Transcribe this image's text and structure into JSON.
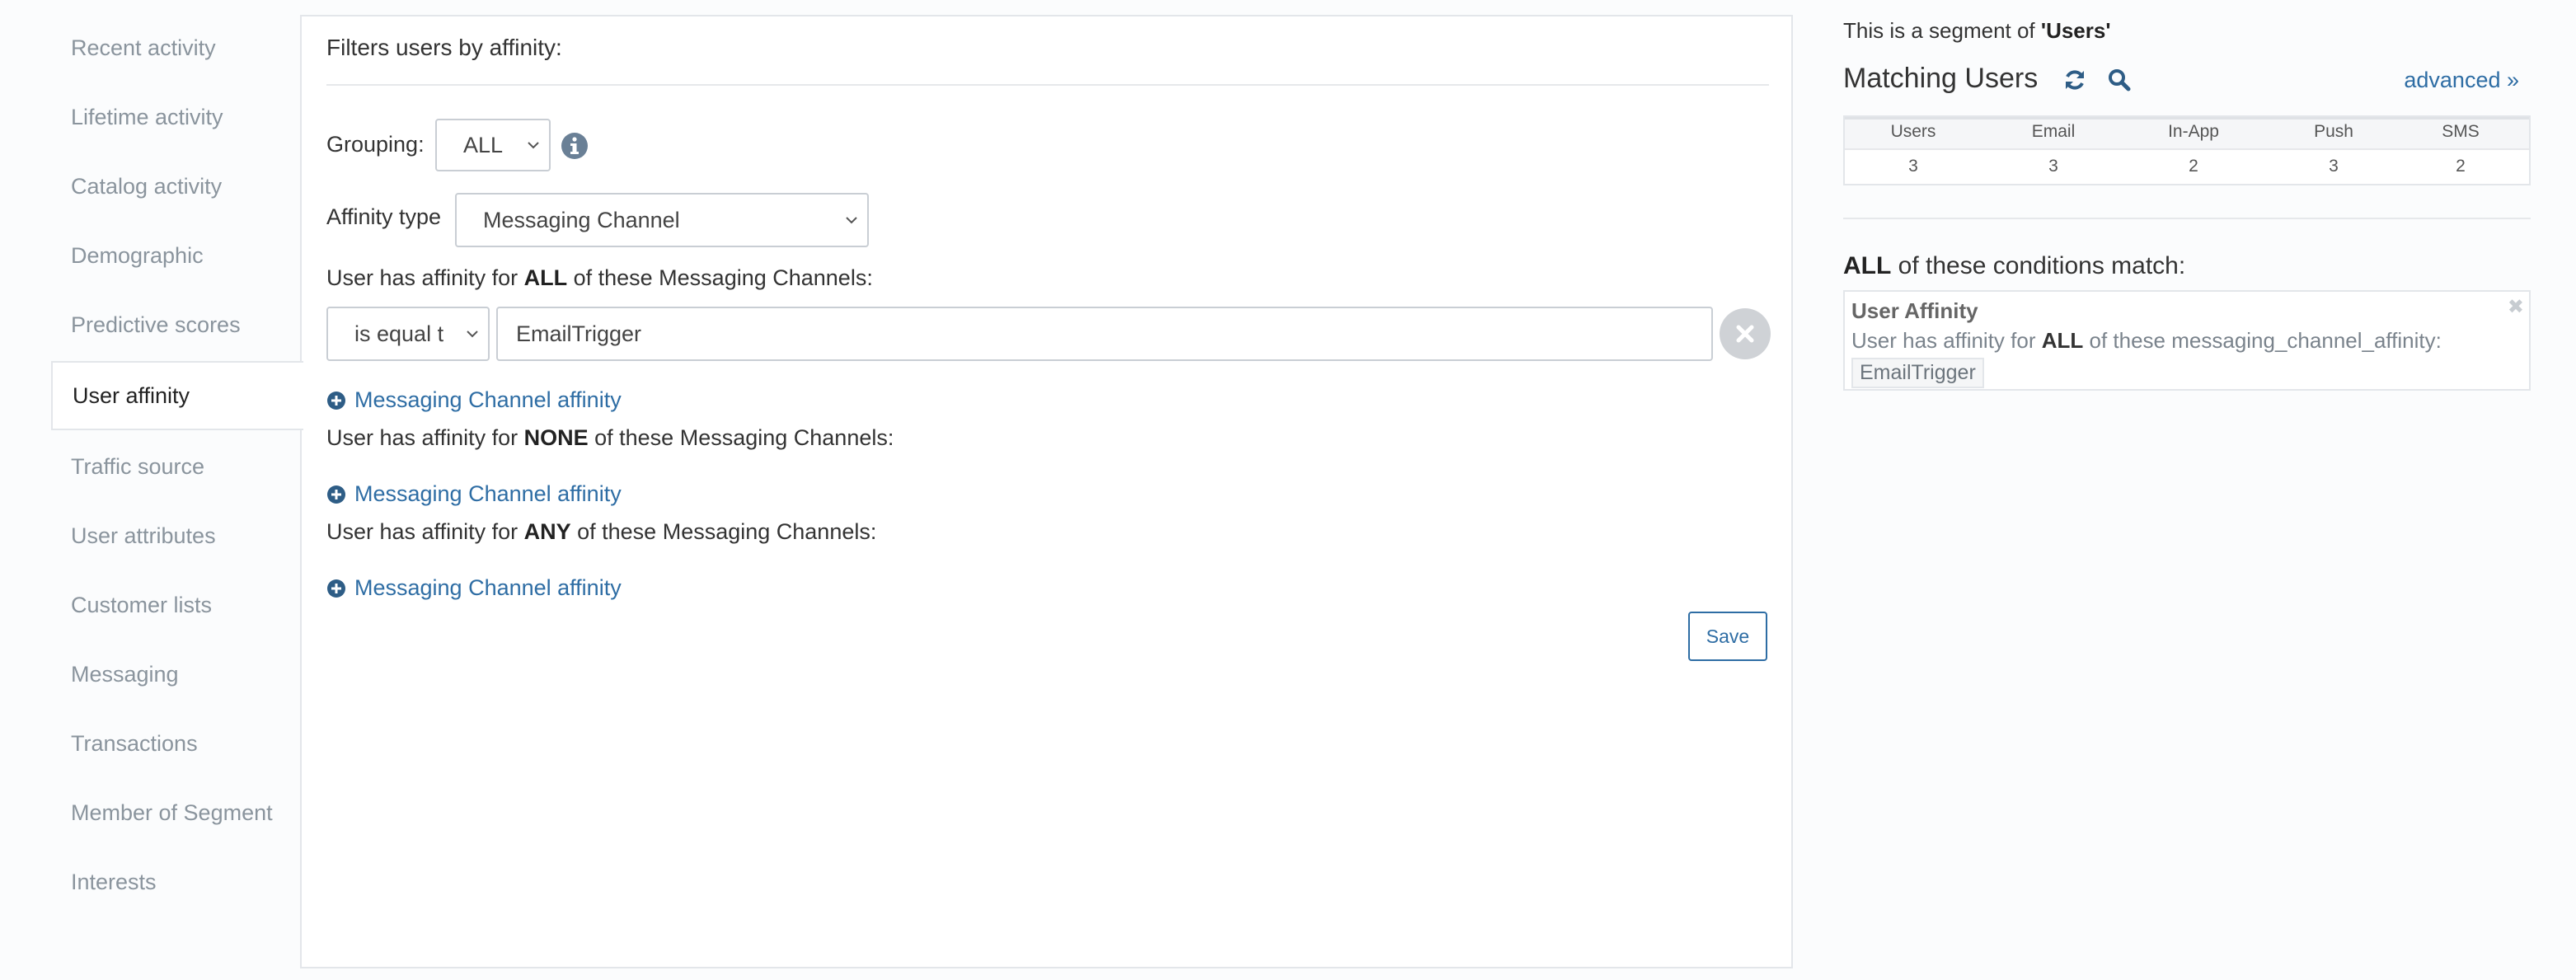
{
  "sidebar": {
    "items": [
      {
        "label": "Recent activity"
      },
      {
        "label": "Lifetime activity"
      },
      {
        "label": "Catalog activity"
      },
      {
        "label": "Demographic"
      },
      {
        "label": "Predictive scores"
      },
      {
        "label": "User affinity"
      },
      {
        "label": "Traffic source"
      },
      {
        "label": "User attributes"
      },
      {
        "label": "Customer lists"
      },
      {
        "label": "Messaging"
      },
      {
        "label": "Transactions"
      },
      {
        "label": "Member of Segment"
      },
      {
        "label": "Interests"
      }
    ],
    "active": "User affinity"
  },
  "filter": {
    "title": "Filters users by affinity:",
    "grouping_label": "Grouping:",
    "grouping_value": "ALL",
    "affinity_type_label": "Affinity type",
    "affinity_type_value": "Messaging Channel",
    "all": {
      "prefix": "User has affinity for ",
      "keyword": "ALL",
      "suffix": " of these Messaging Channels:"
    },
    "condition_operator": "is equal t",
    "condition_value": "EmailTrigger",
    "add_link": "Messaging Channel affinity",
    "none": {
      "prefix": "User has affinity for ",
      "keyword": "NONE",
      "suffix": " of these Messaging Channels:"
    },
    "any": {
      "prefix": "User has affinity for ",
      "keyword": "ANY",
      "suffix": " of these Messaging Channels:"
    },
    "save_label": "Save"
  },
  "segment": {
    "note_prefix": "This is a segment of ",
    "note_name": "'Users'",
    "matching_title": "Matching Users",
    "advanced_link": "advanced »",
    "stats_headers": [
      "Users",
      "Email",
      "In-App",
      "Push",
      "SMS"
    ],
    "stats_values": [
      "3",
      "3",
      "2",
      "3",
      "2"
    ],
    "conditions_keyword": "ALL",
    "conditions_suffix": " of these conditions match:",
    "condition": {
      "title": "User Affinity",
      "desc_prefix": "User has affinity for ",
      "desc_keyword": "ALL",
      "desc_suffix": " of these messaging_channel_affinity:",
      "chip": "EmailTrigger",
      "close": "✖"
    }
  },
  "colors": {
    "link": "#2e6da4",
    "sidebar_text": "#8a949d",
    "border": "#e3e6ea"
  }
}
